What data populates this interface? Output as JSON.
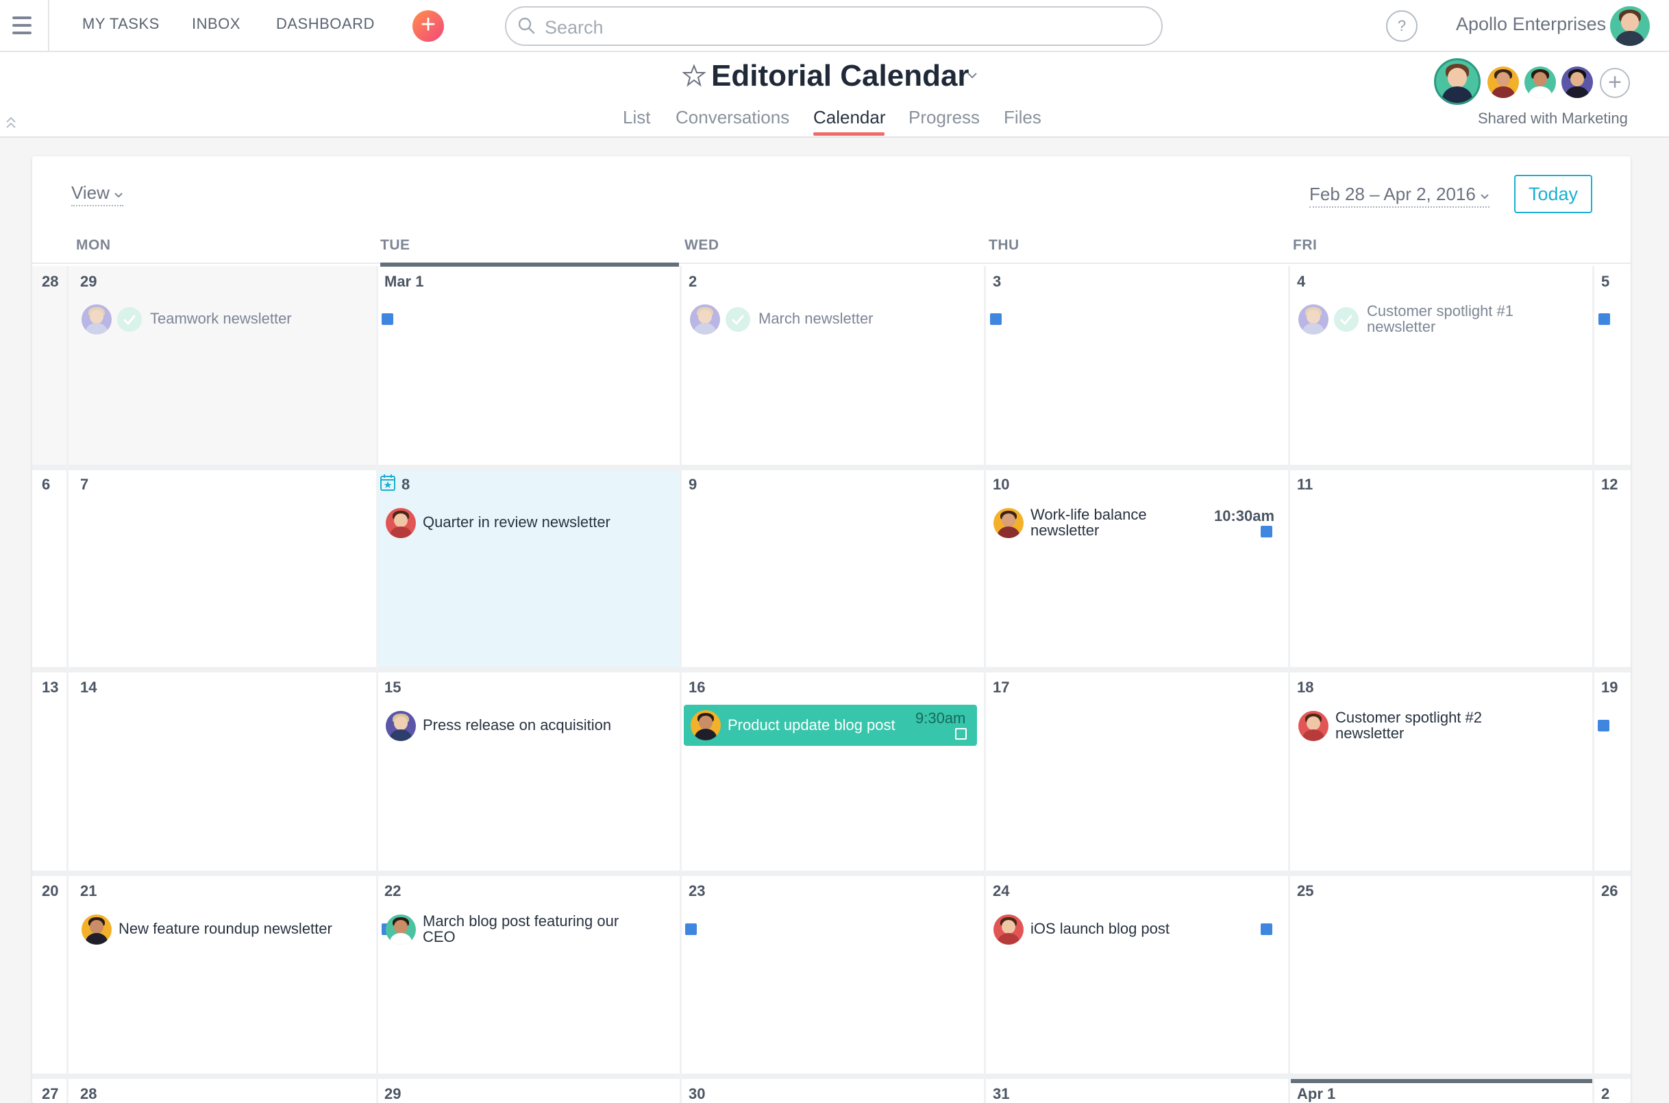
{
  "topbar": {
    "nav": [
      "MY TASKS",
      "INBOX",
      "DASHBOARD"
    ],
    "search_placeholder": "Search",
    "help": "?",
    "org": "Apollo Enterprises"
  },
  "project": {
    "title": "Editorial Calendar",
    "tabs": [
      "List",
      "Conversations",
      "Calendar",
      "Progress",
      "Files"
    ],
    "active_tab": "Calendar",
    "shared": "Shared with Marketing"
  },
  "calendar": {
    "view_label": "View",
    "range": "Feb 28 – Apr 2, 2016",
    "today_label": "Today",
    "days_of_week": [
      "MON",
      "TUE",
      "WED",
      "THU",
      "FRI"
    ],
    "weeks": [
      [
        "28",
        "29",
        "Mar 1",
        "2",
        "3",
        "4",
        "5"
      ],
      [
        "6",
        "7",
        "8",
        "9",
        "10",
        "11",
        "12"
      ],
      [
        "13",
        "14",
        "15",
        "16",
        "17",
        "18",
        "19"
      ],
      [
        "20",
        "21",
        "22",
        "23",
        "24",
        "25",
        "26"
      ],
      [
        "27",
        "28",
        "29",
        "30",
        "31",
        "Apr 1",
        "2"
      ]
    ],
    "tasks": {
      "teamwork": {
        "label": "Teamwork newsletter"
      },
      "march_news": {
        "label": "March newsletter"
      },
      "spotlight1": {
        "line1": "Customer spotlight #1",
        "line2": "newsletter"
      },
      "quarter": {
        "label": "Quarter in review newsletter"
      },
      "worklife": {
        "line1": "Work-life balance",
        "line2": "newsletter",
        "time": "10:30am"
      },
      "press": {
        "label": "Press release on acquisition"
      },
      "product": {
        "label": "Product update blog post",
        "time": "9:30am"
      },
      "spotlight2": {
        "line1": "Customer spotlight #2",
        "line2": "newsletter"
      },
      "roundup": {
        "label": "New feature roundup newsletter"
      },
      "ceo": {
        "line1": "March blog post featuring our",
        "line2": "CEO"
      },
      "ios": {
        "label": "iOS launch blog post"
      }
    }
  },
  "colors": {
    "accent": "#1aafd0",
    "tab_underline": "#f06a6a",
    "task_square": "#3f86e0",
    "highlight_task": "#37c5ab",
    "today_cell": "#e8f6fb"
  }
}
